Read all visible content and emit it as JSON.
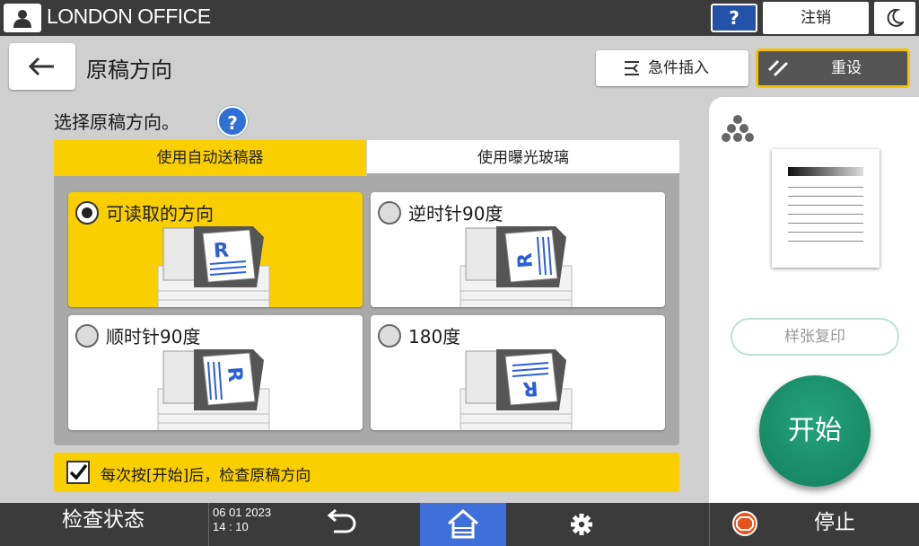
{
  "topbar": {
    "user_icon": "user-icon",
    "office_name": "LONDON OFFICE",
    "help_label": "?",
    "logout_label": "注销",
    "night_icon": "moon-icon"
  },
  "header": {
    "back_icon": "arrow-left-icon",
    "title": "原稿方向",
    "interrupt_label": "急件插入",
    "reset_label": "重设"
  },
  "main": {
    "instruction": "选择原稿方向。",
    "help_label": "?",
    "tabs": [
      {
        "label": "使用自动送稿器",
        "active": true
      },
      {
        "label": "使用曝光玻璃",
        "active": false
      }
    ],
    "options": [
      {
        "label": "可读取的方向",
        "selected": true
      },
      {
        "label": "逆时针90度",
        "selected": false
      },
      {
        "label": "顺时针90度",
        "selected": false
      },
      {
        "label": "180度",
        "selected": false
      }
    ],
    "check_label": "每次按[开始]后，检查原稿方向",
    "check_checked": true
  },
  "right_panel": {
    "color_icon": "color-mode-icon",
    "sample_copy_label": "样张复印",
    "start_label": "开始"
  },
  "bottombar": {
    "check_status_label": "检查状态",
    "date": "06 01 2023",
    "time": "14 : 10",
    "stop_label": "停止"
  },
  "colors": {
    "accent_yellow": "#f9cf00",
    "start_green": "#17916b",
    "home_blue": "#3f6fd8",
    "bar_dark": "#3b3b3b"
  }
}
